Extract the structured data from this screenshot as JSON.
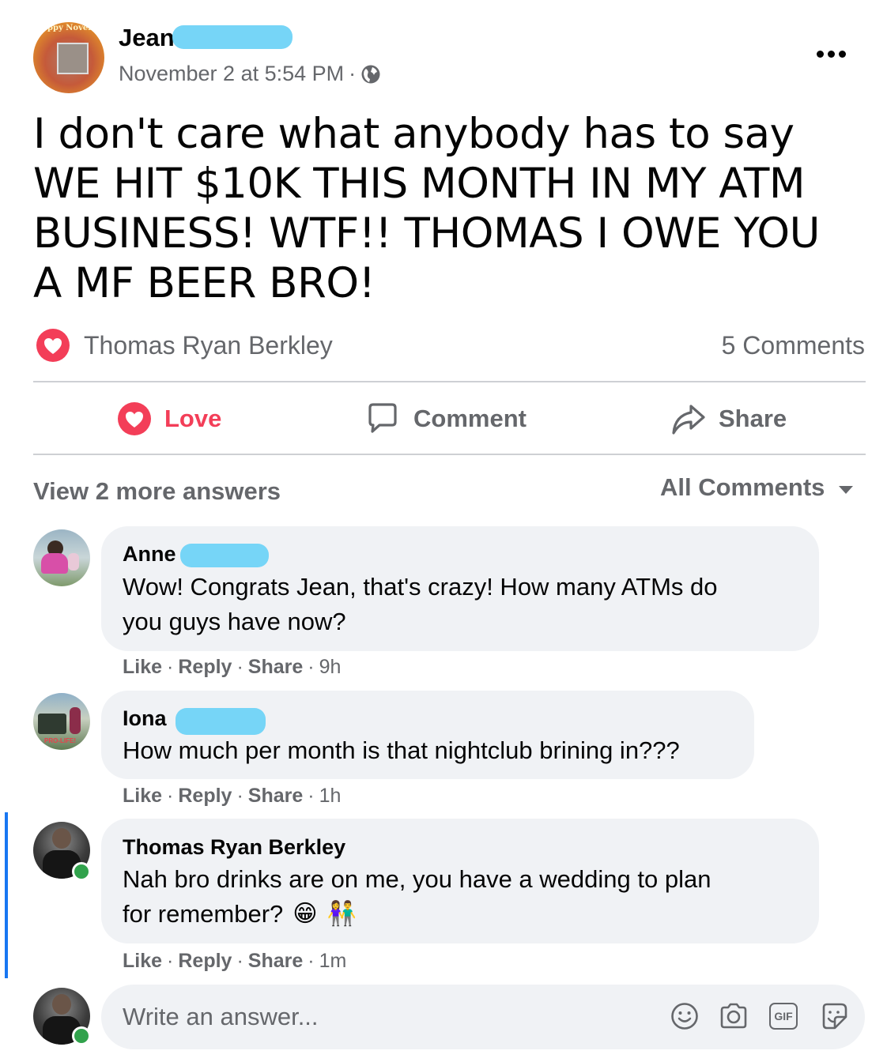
{
  "post": {
    "author": "Jean",
    "timestamp": "November 2 at 5:54 PM",
    "separator": "·",
    "privacy_icon": "globe-icon",
    "body": "I don't care what anybody has to say WE HIT $10K THIS MONTH IN MY ATM BUSINESS! WTF!! THOMAS I OWE YOU A MF BEER BRO!",
    "avatar_text": "ppy Novem"
  },
  "reactions": {
    "icon": "love-reaction-icon",
    "names": "Thomas Ryan Berkley",
    "comments_count": "5 Comments"
  },
  "action_bar": {
    "love": "Love",
    "comment": "Comment",
    "share": "Share"
  },
  "comments_header": {
    "view_more": "View 2 more answers",
    "filter": "All Comments"
  },
  "comments": [
    {
      "name": "Anne",
      "text_line1": "Wow! Congrats Jean, that's crazy! How many ATMs do",
      "text_line2": "you guys have now?",
      "like": "Like",
      "reply": "Reply",
      "share": "Share",
      "time": "9h"
    },
    {
      "name": "Iona",
      "text_line1": "How much per month is that nightclub brining in???",
      "like": "Like",
      "reply": "Reply",
      "share": "Share",
      "time": "1h",
      "avatar_text": "PRO-LIFE!"
    },
    {
      "name": "Thomas Ryan Berkley",
      "text_line1": "Nah bro drinks are on me, you have a wedding to plan",
      "text_line2": "for remember?",
      "emoji1": "😁",
      "emoji2": "👫",
      "like": "Like",
      "reply": "Reply",
      "share": "Share",
      "time": "1m"
    }
  ],
  "composer": {
    "placeholder": "Write an answer...",
    "icons": [
      "smiley-icon",
      "camera-icon",
      "gif-icon",
      "sticker-icon"
    ],
    "gif_label": "GIF"
  },
  "colors": {
    "love_red": "#f33e58",
    "secondary_text": "#65676b",
    "bubble_bg": "#f0f2f5",
    "online_green": "#31a24c",
    "thread_line": "#1877f2"
  }
}
